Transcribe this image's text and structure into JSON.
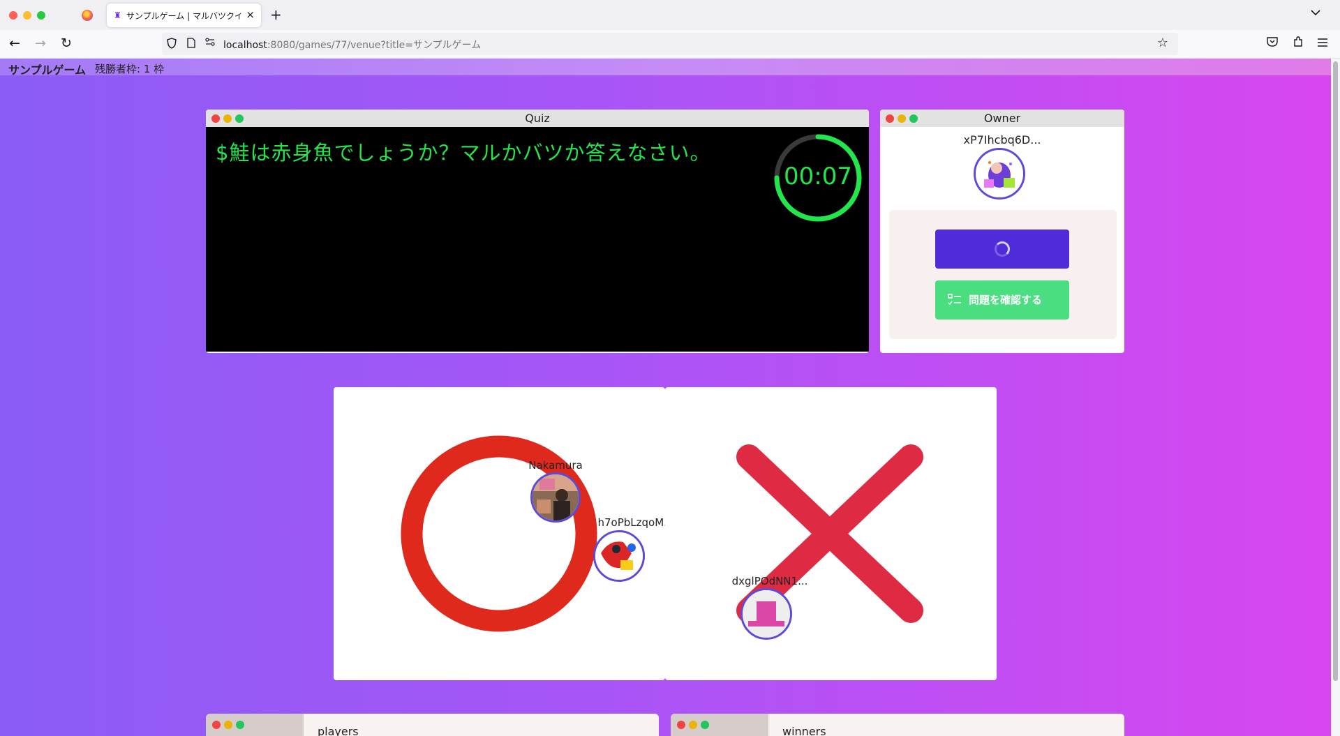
{
  "browser": {
    "tab_title": "サンプルゲーム | マルバツクイズ",
    "tab_close": "×",
    "new_tab": "+",
    "tab_list": "⌄",
    "url_host": "localhost",
    "url_rest": ":8080/games/77/venue?title=サンプルゲーム"
  },
  "header": {
    "game_title": "サンプルゲーム",
    "remaining": "残勝者枠: 1 枠"
  },
  "quiz": {
    "window_title": "Quiz",
    "question": "$鮭は赤身魚でしょうか？マルかバツか答えなさい。",
    "timer": "00:07",
    "timer_progress": 0.75,
    "text_color": "#22e64a"
  },
  "owner": {
    "window_title": "Owner",
    "name": "xP7Ihcbq6D...",
    "primary_button_state": "loading",
    "check_button_label": "問題を確認する"
  },
  "answers": {
    "maru": {
      "symbol": "circle",
      "color": "#e0291d",
      "players": [
        {
          "name": "Nakamura"
        },
        {
          "name": "h7oPbLzqoM..."
        }
      ]
    },
    "batsu": {
      "symbol": "cross",
      "color": "#df2a44",
      "players": [
        {
          "name": "dxglPOdNN1..."
        }
      ]
    }
  },
  "bottom": {
    "players_title": "players",
    "winners_title": "winners"
  },
  "colors": {
    "accent": "#4f2bd9",
    "success": "#4ade80",
    "avatar_border": "#5b4bd8"
  }
}
